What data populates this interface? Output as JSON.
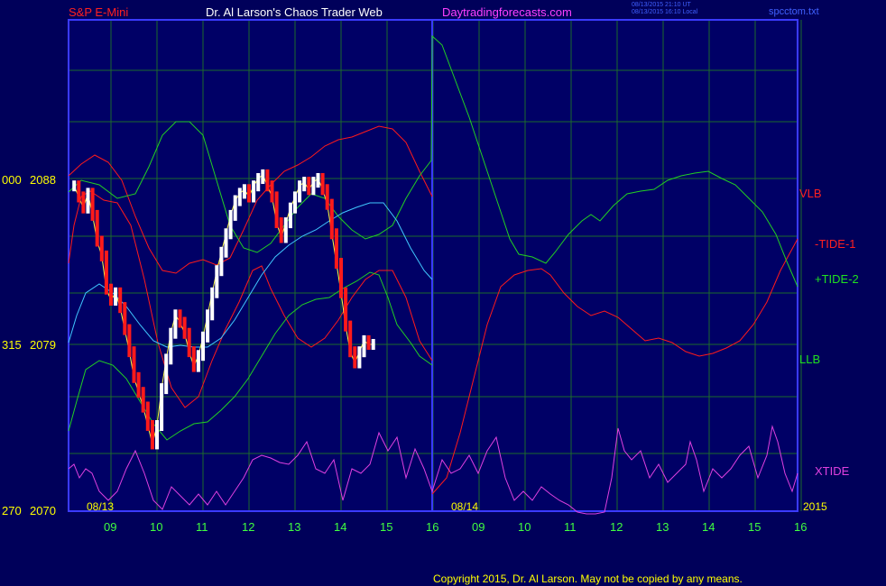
{
  "header": {
    "instrument": "S&P E-Mini",
    "author": "Dr. Al Larson's Chaos Trader Web",
    "site": "Daytradingforecasts.com",
    "timestamp_ut": "08/13/2015 21:10 UT",
    "timestamp_local": "08/13/2015 16:10 Local",
    "file": "spcctom.txt"
  },
  "footer": {
    "copyright": "Copyright 2015, Dr. Al Larson. May not be copied by any means."
  },
  "colors": {
    "background": "#00005a",
    "plot_bg": "#000066",
    "grid": "#1c6a2c",
    "frame": "#3a3aff",
    "red": "#ff1a1a",
    "green": "#22d022",
    "magenta": "#e040e0",
    "cyan": "#40c8ff",
    "yellow": "#ffff40",
    "axis_text": "#ffff00",
    "hour_text": "#40ff40"
  },
  "chart_data": {
    "type": "line",
    "title": "S&P E-Mini",
    "y_labels": [
      {
        "left": "000",
        "price": "2088",
        "value": 2088
      },
      {
        "left": "315",
        "price": "2079",
        "value": 2079
      },
      {
        "left": "270",
        "price": "2070",
        "value": 2070
      }
    ],
    "ylim": [
      2070,
      2088
    ],
    "grid": true,
    "date_labels": [
      "08/13",
      "08/14"
    ],
    "x_ticks": [
      "09",
      "10",
      "11",
      "12",
      "13",
      "14",
      "15",
      "16",
      "09",
      "10",
      "11",
      "12",
      "13",
      "14",
      "15",
      "16"
    ],
    "year_label": "2015",
    "series_labels": [
      {
        "name": "VLB",
        "color": "#ff2020"
      },
      {
        "name": "-TIDE-1",
        "color": "#ff2020"
      },
      {
        "name": "+TIDE-2",
        "color": "#20e020"
      },
      {
        "name": "LLB",
        "color": "#20e020"
      },
      {
        "name": "XTIDE",
        "color": "#e040e0"
      }
    ],
    "price_candles_note": "",
    "candles": [
      [
        0.0,
        2087.6
      ],
      [
        0.1,
        2087.0
      ],
      [
        0.2,
        2086.4
      ],
      [
        0.3,
        2087.2
      ],
      [
        0.4,
        2086.0
      ],
      [
        0.5,
        2084.6
      ],
      [
        0.6,
        2083.8
      ],
      [
        0.7,
        2082.0
      ],
      [
        0.8,
        2081.4
      ],
      [
        0.9,
        2081.8
      ],
      [
        1.0,
        2081.0
      ],
      [
        1.1,
        2079.8
      ],
      [
        1.2,
        2078.6
      ],
      [
        1.3,
        2077.2
      ],
      [
        1.4,
        2076.4
      ],
      [
        1.5,
        2075.6
      ],
      [
        1.6,
        2074.6
      ],
      [
        1.7,
        2073.6
      ],
      [
        1.8,
        2074.6
      ],
      [
        1.9,
        2076.6
      ],
      [
        2.0,
        2078.2
      ],
      [
        2.1,
        2079.6
      ],
      [
        2.2,
        2080.6
      ],
      [
        2.3,
        2080.2
      ],
      [
        2.4,
        2079.6
      ],
      [
        2.5,
        2078.6
      ],
      [
        2.6,
        2077.8
      ],
      [
        2.7,
        2078.4
      ],
      [
        2.8,
        2079.4
      ],
      [
        2.9,
        2080.6
      ],
      [
        3.0,
        2081.8
      ],
      [
        3.1,
        2083.0
      ],
      [
        3.2,
        2084.0
      ],
      [
        3.3,
        2085.0
      ],
      [
        3.4,
        2086.0
      ],
      [
        3.5,
        2086.8
      ],
      [
        3.6,
        2087.2
      ],
      [
        3.7,
        2087.4
      ],
      [
        3.8,
        2087.0
      ],
      [
        3.9,
        2087.6
      ],
      [
        4.0,
        2088.0
      ],
      [
        4.1,
        2088.2
      ],
      [
        4.2,
        2087.6
      ],
      [
        4.3,
        2087.0
      ],
      [
        4.4,
        2085.6
      ],
      [
        4.5,
        2084.8
      ],
      [
        4.6,
        2085.6
      ],
      [
        4.7,
        2086.4
      ],
      [
        4.8,
        2087.0
      ],
      [
        4.9,
        2087.6
      ],
      [
        5.0,
        2087.8
      ],
      [
        5.1,
        2087.4
      ],
      [
        5.2,
        2087.8
      ],
      [
        5.3,
        2088.0
      ],
      [
        5.4,
        2087.4
      ],
      [
        5.5,
        2086.6
      ],
      [
        5.6,
        2085.0
      ],
      [
        5.7,
        2083.4
      ],
      [
        5.8,
        2081.8
      ],
      [
        5.9,
        2080.0
      ],
      [
        6.0,
        2078.6
      ],
      [
        6.1,
        2078.0
      ],
      [
        6.2,
        2078.6
      ],
      [
        6.3,
        2079.2
      ],
      [
        6.4,
        2079.0
      ],
      [
        6.5,
        2079.0
      ]
    ]
  }
}
